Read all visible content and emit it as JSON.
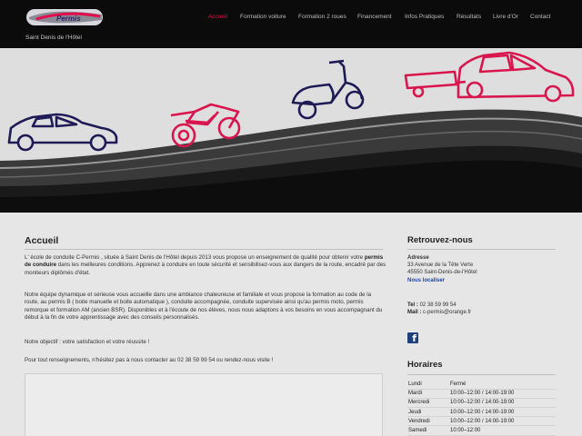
{
  "header": {
    "logo_text": "Permis",
    "tagline": "Saint Denis de l'Hôtel",
    "nav": [
      {
        "label": "Accueil",
        "active": true
      },
      {
        "label": "Formation voiture",
        "active": false
      },
      {
        "label": "Formation 2 roues",
        "active": false
      },
      {
        "label": "Financement",
        "active": false
      },
      {
        "label": "Infos Pratiques",
        "active": false
      },
      {
        "label": "Résultats",
        "active": false
      },
      {
        "label": "Livre d'Or",
        "active": false
      },
      {
        "label": "Contact",
        "active": false
      }
    ]
  },
  "colors": {
    "accent": "#e30c4d",
    "dark": "#0b0b0b",
    "vehicle_blue": "#1d1a55",
    "vehicle_red": "#d9154e",
    "link": "#1c45a8"
  },
  "banner": {
    "icons": [
      "car-icon",
      "motorcycle-icon",
      "scooter-icon",
      "car-with-trailer-icon"
    ]
  },
  "main": {
    "title": "Accueil",
    "p1_a": "L' école de conduite C-Permis , située à Saint Denis de l'Hôtel depuis 2013 vous propose un enseignement de qualité pour obtenir votre ",
    "p1_bold": "permis de conduire",
    "p1_b": " dans les meilleures conditions. Apprenez à conduire en toute sécurité et sensibilisez-vous aux dangers de la route, encadré par des moniteurs diplômés d'état.",
    "p2": "Notre équipe dynamique et sérieuse vous accueille dans une ambiance chaleureuse et familiale  et vous propose la formation au code de la route, au permis B ( boite manuelle et boite automatique ), conduite accompagnée, conduite supervisée ainsi qu'au permis moto, permis remorque et formation AM (ancien BSR). Disponibles et à l'écoute de nos élèves, nous nous adaptons à vos besoins en vous accompagnant du début à la fin de votre apprentissage avec des conseils personnalisés.",
    "p3": "Notre objectif : votre satisfaction et votre réussite !",
    "p4": "Pour tout renseignements, n'hésitez pas à nous contacter au 02 38 59 99 54 ou rendez-nous visite !"
  },
  "sidebar": {
    "title": "Retrouvez-nous",
    "address_label": "Adresse",
    "address_line1": "33 Avenue de la Tête Verte",
    "address_line2": "45550 Saint-Denis-de-l'Hôtel",
    "map_link": "Nous localiser",
    "tel_label": "Tel :",
    "tel": "02 38 59 99 54",
    "mail_label": "Mail :",
    "mail": "c-permis@orange.fr",
    "hours_title": "Horaires",
    "hours": [
      {
        "day": "Lundi",
        "time": "Fermé"
      },
      {
        "day": "Mardi",
        "time": "10:00–12:00 / 14:00-19:00"
      },
      {
        "day": "Mercredi",
        "time": "10:00–12:00 / 14:00-19:00"
      },
      {
        "day": "Jeudi",
        "time": "10:00–12:00 / 14:00-19:00"
      },
      {
        "day": "Vendredi",
        "time": "10:00–12:00 / 14:00-19:00"
      },
      {
        "day": "Samedi",
        "time": "10:00–12:00"
      }
    ]
  }
}
